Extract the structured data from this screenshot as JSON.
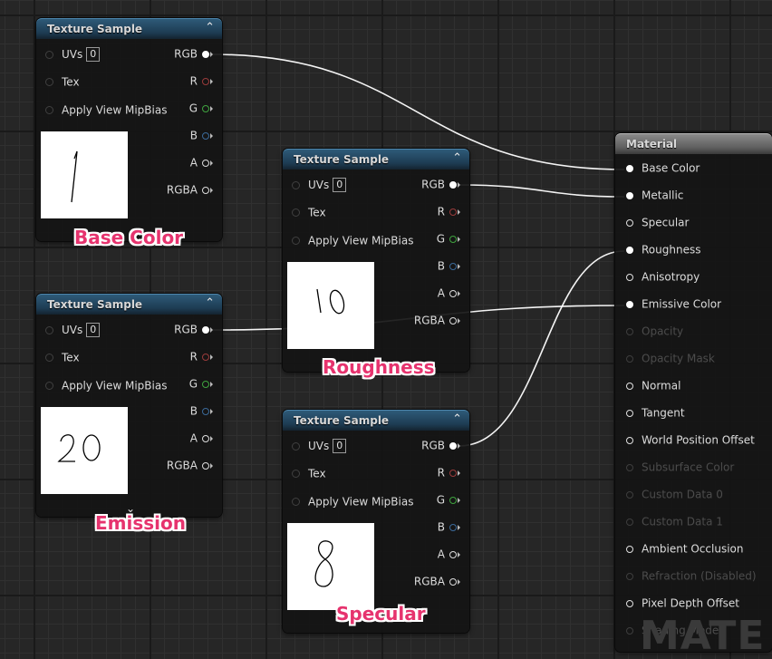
{
  "texture_nodes": [
    {
      "id": "base",
      "title": "Texture Sample",
      "inputs": [
        "UVs",
        "Tex",
        "Apply View MipBias"
      ],
      "uv_value": "0",
      "outputs": [
        "RGB",
        "R",
        "G",
        "B",
        "A",
        "RGBA"
      ],
      "preview_text": "1",
      "callout": "Base  Color"
    },
    {
      "id": "emission",
      "title": "Texture Sample",
      "inputs": [
        "UVs",
        "Tex",
        "Apply View MipBias"
      ],
      "uv_value": "0",
      "outputs": [
        "RGB",
        "R",
        "G",
        "B",
        "A",
        "RGBA"
      ],
      "preview_text": "20",
      "callout": "Emission"
    },
    {
      "id": "roughness",
      "title": "Texture Sample",
      "inputs": [
        "UVs",
        "Tex",
        "Apply View MipBias"
      ],
      "uv_value": "0",
      "outputs": [
        "RGB",
        "R",
        "G",
        "B",
        "A",
        "RGBA"
      ],
      "preview_text": "10",
      "callout": "Roughness"
    },
    {
      "id": "specular",
      "title": "Texture Sample",
      "inputs": [
        "UVs",
        "Tex",
        "Apply View MipBias"
      ],
      "uv_value": "0",
      "outputs": [
        "RGB",
        "R",
        "G",
        "B",
        "A",
        "RGBA"
      ],
      "preview_text": "8",
      "callout": "Specular"
    }
  ],
  "material": {
    "title": "Material",
    "watermark": "MATE",
    "inputs": [
      {
        "label": "Base Color",
        "state": "connected"
      },
      {
        "label": "Metallic",
        "state": "connected"
      },
      {
        "label": "Specular",
        "state": "open"
      },
      {
        "label": "Roughness",
        "state": "connected"
      },
      {
        "label": "Anisotropy",
        "state": "open"
      },
      {
        "label": "Emissive Color",
        "state": "connected"
      },
      {
        "label": "Opacity",
        "state": "disabled"
      },
      {
        "label": "Opacity Mask",
        "state": "disabled"
      },
      {
        "label": "Normal",
        "state": "open"
      },
      {
        "label": "Tangent",
        "state": "open"
      },
      {
        "label": "World Position Offset",
        "state": "open"
      },
      {
        "label": "Subsurface Color",
        "state": "disabled"
      },
      {
        "label": "Custom Data 0",
        "state": "disabled"
      },
      {
        "label": "Custom Data 1",
        "state": "disabled"
      },
      {
        "label": "Ambient Occlusion",
        "state": "open"
      },
      {
        "label": "Refraction (Disabled)",
        "state": "disabled"
      },
      {
        "label": "Pixel Depth Offset",
        "state": "open"
      },
      {
        "label": "Shading Model",
        "state": "disabled"
      }
    ]
  },
  "colors": {
    "callout": "#e6336e",
    "header_texture": "#2e5a78",
    "header_material": "#8a8a8a",
    "pin_r": "#9a3b3b",
    "pin_g": "#3fa43f",
    "pin_b": "#3b6a9a"
  },
  "icons": {
    "collapse": "chevron-up-icon",
    "expand": "chevron-down-icon",
    "output_pin": "circle-pin-icon"
  }
}
